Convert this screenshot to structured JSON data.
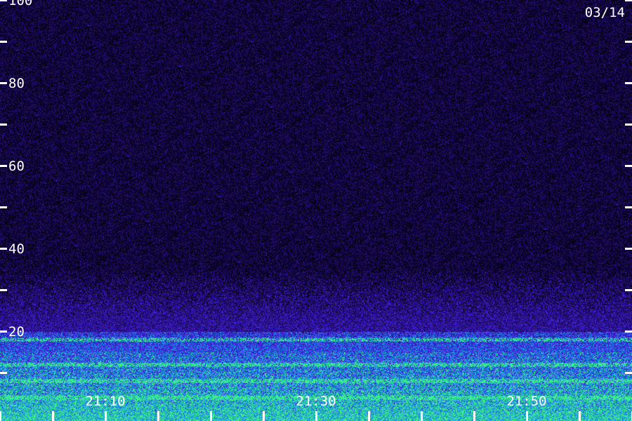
{
  "chart_data": {
    "type": "heatmap",
    "date_label": "03/14",
    "y_axis": {
      "range": [
        0,
        110
      ],
      "tick_step": 10,
      "labeled_ticks": [
        20,
        40,
        60,
        80,
        100
      ],
      "tick_labels": [
        "20",
        "40",
        "60",
        "80",
        "100"
      ]
    },
    "x_axis": {
      "range": [
        "21:00",
        "21:59"
      ],
      "minor_tick_minutes": 5,
      "major_tick_labels": [
        "21:10",
        "21:30",
        "21:50"
      ]
    },
    "colors": {
      "background_low": "#1a0a5a",
      "noise_mid": "#3a1ad0",
      "band_cyan": "#1ab0e0",
      "band_green": "#3cf08a",
      "text": "#ffffff"
    },
    "signal_bands": [
      {
        "level": 18,
        "intensity": "high"
      },
      {
        "level": 12,
        "intensity": "high"
      },
      {
        "level": 8,
        "intensity": "high"
      },
      {
        "level": 4,
        "intensity": "high"
      }
    ]
  }
}
